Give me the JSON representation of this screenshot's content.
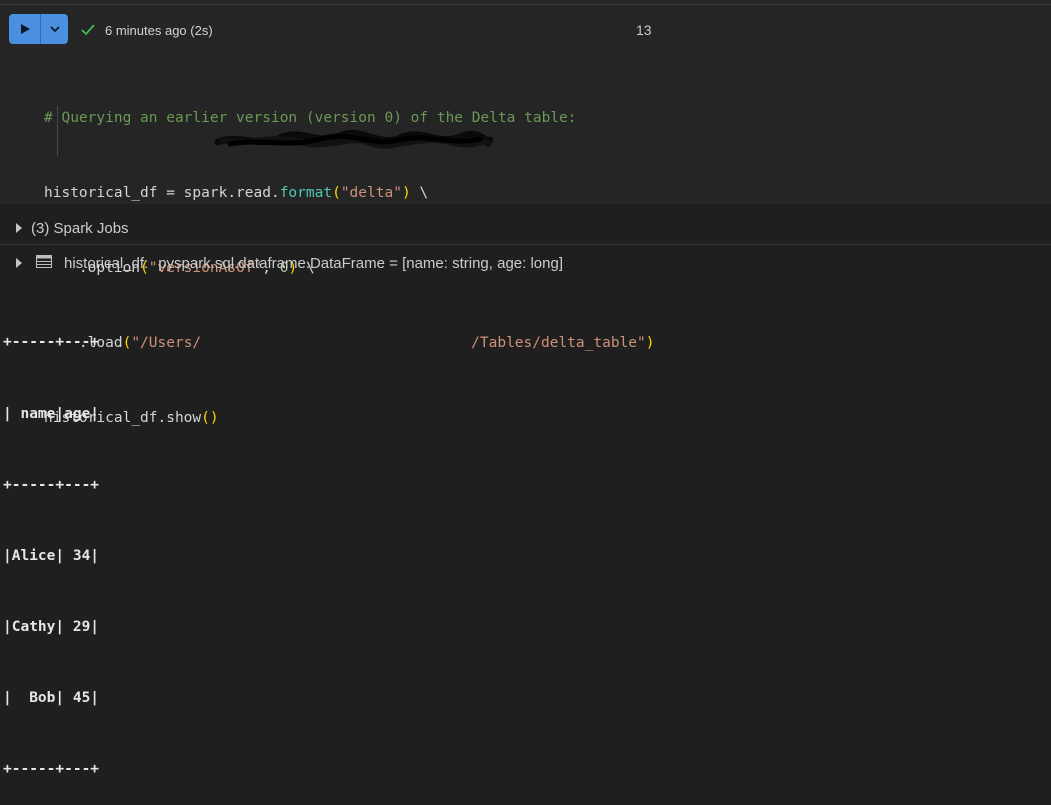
{
  "cell": {
    "run_button_label": "Run cell",
    "status_text": "6 minutes ago (2s)",
    "execution_count": "13",
    "code": {
      "comment": "# Querying an earlier version (version 0) of the Delta table:",
      "line2": {
        "var": "historical_df = spark.read.",
        "fn": "format",
        "open": "(",
        "arg": "\"delta\"",
        "close": ")",
        "tail": " \\"
      },
      "line3": {
        "indent": "    .option",
        "open": "(",
        "arg1": "\"versionAsOf\"",
        "comma": ", ",
        "arg2": "0",
        "close": ")",
        "tail": " \\"
      },
      "line4": {
        "indent": "    .load",
        "open": "(",
        "arg_start": "\"/Users/",
        "arg_end": "/Tables/delta_table\"",
        "close": ")"
      },
      "line5": {
        "code": "historical_df.show",
        "parens": "()"
      }
    }
  },
  "spark_jobs": {
    "label": "(3) Spark Jobs"
  },
  "schema": {
    "var": "historical_df:",
    "type": "pyspark.sql.dataframe.DataFrame = [name: string, age: long]"
  },
  "output": {
    "lines": [
      "+-----+---+",
      "| name|age|",
      "+-----+---+",
      "|Alice| 34|",
      "|Cathy| 29|",
      "|  Bob| 45|",
      "+-----+---+"
    ]
  },
  "icons": {
    "run": "play-icon",
    "dropdown": "chevron-down-icon",
    "status": "checkmark-icon",
    "expand": "caret-right-icon",
    "table": "table-icon"
  },
  "colors": {
    "run_button": "#4a8fe0",
    "check": "#3fb950",
    "comment": "#6a9955",
    "string": "#ce9178",
    "number": "#b5cea8",
    "function": "#4ec9b0"
  }
}
